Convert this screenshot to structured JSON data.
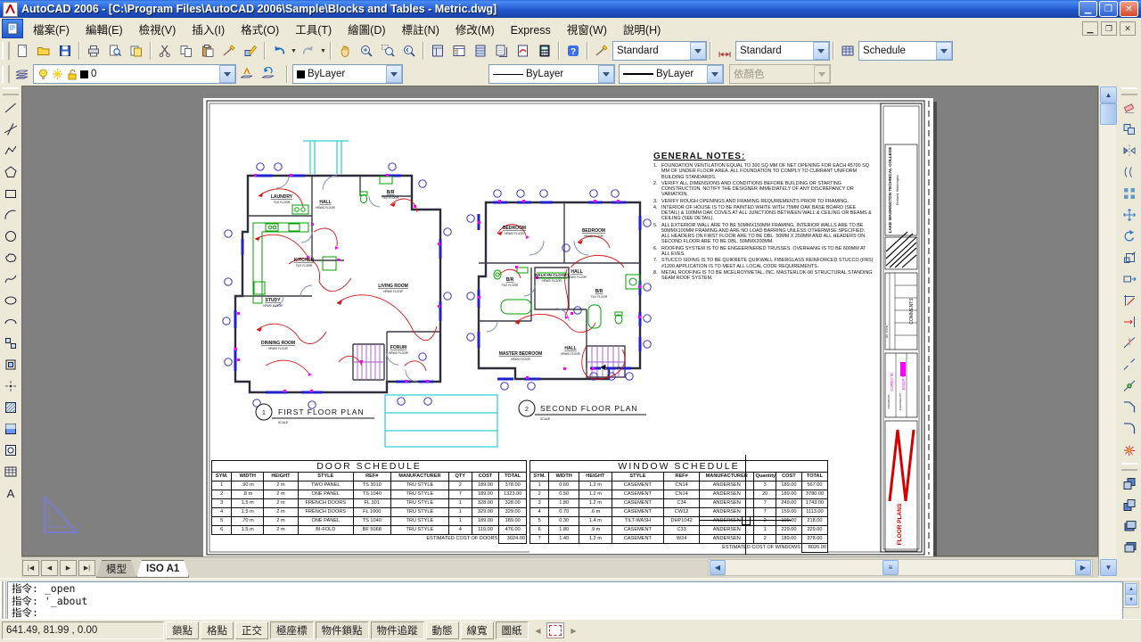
{
  "window": {
    "title": "AutoCAD 2006 - [C:\\Program Files\\AutoCAD 2006\\Sample\\Blocks and Tables - Metric.dwg]",
    "minimize": "_",
    "restore": "❐",
    "close": "✕"
  },
  "menu": {
    "items": [
      "檔案(F)",
      "編輯(E)",
      "檢視(V)",
      "插入(I)",
      "格式(O)",
      "工具(T)",
      "繪圖(D)",
      "標註(N)",
      "修改(M)",
      "Express",
      "視窗(W)",
      "說明(H)"
    ]
  },
  "toolbars": {
    "standard_icons": [
      "new",
      "open",
      "save",
      "plot",
      "plot-preview",
      "publish",
      "cut",
      "copy",
      "paste",
      "match-properties",
      "block-editor",
      "undo",
      "redo",
      "pan",
      "zoom-realtime",
      "zoom-window",
      "zoom-previous",
      "properties",
      "designcenter",
      "tool-palettes",
      "sheet-set-manager",
      "markup-set-manager",
      "quickcalc",
      "help"
    ],
    "styles": {
      "text_style": "Standard",
      "dim_style": "Standard",
      "table_style": "Schedule"
    },
    "layers": {
      "current_layer": "0"
    },
    "properties": {
      "color": "ByLayer",
      "linetype": "ByLayer",
      "lineweight": "ByLayer",
      "plot_style": "依顏色"
    },
    "draw_icons": [
      "line",
      "construction-line",
      "polyline",
      "polygon",
      "rectangle",
      "arc",
      "circle",
      "revision-cloud",
      "spline",
      "ellipse",
      "ellipse-arc",
      "insert-block",
      "make-block",
      "point",
      "hatch",
      "gradient",
      "region",
      "table",
      "multiline-text"
    ],
    "modify_icons": [
      "erase",
      "copy-object",
      "mirror",
      "offset",
      "array",
      "move",
      "rotate",
      "scale",
      "stretch",
      "trim",
      "extend",
      "break-at-point",
      "break",
      "join",
      "chamfer",
      "fillet",
      "explode"
    ],
    "draworder_icons": [
      "draworder-front",
      "draworder-back",
      "draworder-above",
      "draworder-under"
    ]
  },
  "drawing": {
    "plan1": {
      "tag": "1",
      "title": "FIRST FLOOR PLAN",
      "scale_note": "SCALE",
      "rooms": [
        {
          "name": "LAUNDRY",
          "floor": "TILE FLOOR"
        },
        {
          "name": "HALL",
          "floor": "HRWD FLOOR"
        },
        {
          "name": "B/R",
          "floor": "TILE FLOOR"
        },
        {
          "name": "KITCHEN",
          "floor": "TILE FLOOR"
        },
        {
          "name": "LIVING ROOM",
          "floor": "HRWD FLOOR"
        },
        {
          "name": "STUDY",
          "floor": "HRWD FLOOR"
        },
        {
          "name": "DINNING ROOM",
          "floor": "HRWD FLOOR"
        },
        {
          "name": "FORUM",
          "floor": "HRWD FLOOR"
        }
      ]
    },
    "plan2": {
      "tag": "2",
      "title": "SECOND FLOOR PLAN",
      "scale_note": "SCALE",
      "rooms": [
        {
          "name": "BEDROOM",
          "floor": "HRWD FLOOR"
        },
        {
          "name": "BEDROOM",
          "floor": "HRWD FLOOR"
        },
        {
          "name": "WALK-IN CLOSET",
          "floor": "HRWD FLOOR"
        },
        {
          "name": "HALL",
          "floor": "HRWD FLOOR"
        },
        {
          "name": "B/R",
          "floor": "TILE FLOOR"
        },
        {
          "name": "B/R",
          "floor": "TILE FLOOR"
        },
        {
          "name": "MASTER BEDROOM",
          "floor": "HRWD FLOOR"
        },
        {
          "name": "HALL",
          "floor": "HRWD FLOOR"
        }
      ]
    },
    "general_notes": {
      "title": "GENERAL NOTES:",
      "items": [
        "FOUNDATION VENTILATION EQUAL TO 300 SQ MM OF NET OPENING FOR EACH 45700 SQ MM OF UNDER FLOOR AREA. ALL FOUNDATION TO COMPLY TO CURRANT UNIFORM BUILDING STANDARDS.",
        "VERIFY ALL DIMENSIONS AND CONDITIONS BEFORE BUILDING OR STARTING CONSTRUCTION. NOTIFY THE DESIGNER IMMEDIATELY OF ANY DISCREPANCY OR VARIATION.",
        "VERIFY ROUGH OPENINGS AND FRAMING REQUIREMENTS PRIOR TO FRAMING.",
        "INTERIOR OF HOUSE IS TO BE PAINTED WHITE WITH 75MM OAK  BASE BOARD (SEE DETAIL) & 100MM OAK COVES AT ALL JUNCTIONS BETWEEN WALL & CEILING OR BEAMS & CEILING (SEE DETAIL).",
        "ALL EXTERIOR WALL ARE TO BE 50MMX150MM FRAMING. INTERIOR WALLS ARE TO BE 50MMX100MM FRAMING AND ARE NO LOAD BARRING UNLESS OTHERWISE SPECIFIED. ALL HEADERS ON FIRST FLOOR ARE TO BE DBL. 50MM X 250MM AND ALL HEADERS ON SECOND FLOOR ARE TO BE DBL. 50MMX200MM.",
        "ROOFING SYSTEM IS TO BE ENGEERINERED TRUSSES. OVERHANG IS TO BE 600MM AT ALL EVES.",
        "STUCCO SIDING IS TO BE QUIKRETE QUIKWALL FIBERGLASS REINFORCED STUCCO (FRS) #1200 APPLICATION IS TO MEET ALL LOCAL CODE REQUIREMENTS.",
        "METAL ROOFING IS TO BE MCELROYMETAL, INC. MASTERLOK-90 STRUCTURAL STANDING SEAM ROOF SYSTEM."
      ]
    },
    "schedules": {
      "door": {
        "title": "DOOR SCHEDULE",
        "headers": [
          "SYM.",
          "WIDTH",
          "HEIGHT",
          "STYLE",
          "REF#",
          "MANUFACTURER",
          "QTY",
          "COST",
          "TOTAL"
        ],
        "rows": [
          [
            "1",
            ".90 m",
            "2 m",
            "TWO PANEL",
            "TS 3010",
            "TRU STYLE",
            "2",
            "189.00",
            "378.00"
          ],
          [
            "2",
            ".8 m",
            "2 m",
            "ONE PANEL",
            "TS 1040",
            "TRU STYLE",
            "7",
            "189.00",
            "1323.00"
          ],
          [
            "3",
            "1.5 m",
            "2 m",
            "FRENCH DOORS",
            "FL 301",
            "TRU STYLE",
            "1",
            "328.00",
            "328.00"
          ],
          [
            "4",
            "1.5 m",
            "2 m",
            "FRENCH DOORS",
            "FL 1000",
            "TRU STYLE",
            "1",
            "329.00",
            "329.00"
          ],
          [
            "5",
            ".70 m",
            "2 m",
            "ONE PANEL",
            "TS 1040",
            "TRU STYLE",
            "1",
            "189.00",
            "189.00"
          ],
          [
            "6",
            "1.5 m",
            "2 m",
            "BI-FOLD",
            "BF 5068",
            "TRU STYLE",
            "4",
            "119.00",
            "476.00"
          ]
        ],
        "footer_label": "ESTIMATED COST OF DOORS",
        "footer_value": "3024.00"
      },
      "window": {
        "title": "WINDOW SCHEDULE",
        "headers": [
          "SYM.",
          "WIDTH",
          "HEIGHT",
          "STYLE",
          "REF#",
          "MANUFACTURER",
          "Quantity",
          "COST",
          "TOTAL"
        ],
        "rows": [
          [
            "1",
            "0.60",
            "1.2 m",
            "CASEMENT",
            "CN14",
            "ANDERSEN",
            "3",
            "189.00",
            "567.00"
          ],
          [
            "2",
            "0.50",
            "1.2 m",
            "CASEMENT",
            "CN14",
            "ANDERSEN",
            "20",
            "189.00",
            "3780.00"
          ],
          [
            "3",
            "1.80",
            "1.2 m",
            "CASEMENT",
            "C34",
            "ANDERSEN",
            "7",
            "249.00",
            "1743.00"
          ],
          [
            "4",
            "0.70",
            ".6 m",
            "CASEMENT",
            "CW12",
            "ANDERSEN",
            "7",
            "159.00",
            "1113.00"
          ],
          [
            "5",
            "0.30",
            "1.4 m",
            "TILT-WASH",
            "DHP1042",
            "ANDERSEN",
            "2",
            "109.00",
            "218.00"
          ],
          [
            "6",
            "1.80",
            ".9 m",
            "CASEMENT",
            "C33",
            "ANDERSEN",
            "1",
            "229.00",
            "229.00"
          ],
          [
            "7",
            "1.40",
            "1.2 m",
            "CASEMENT",
            "W24",
            "ANDERSEN",
            "2",
            "189.00",
            "378.00"
          ]
        ],
        "footer_label": "ESTIMATED COST OF WINDOWS",
        "footer_value": "8026.00"
      }
    },
    "title_block": {
      "college": "LAKE WASHINGTON TECHNICAL COLLEGE",
      "location": "Kirkland, Washington",
      "comments_label": "COMMENTS",
      "no_date_label": "NO. DATE",
      "drawn_label": "DRAWN BY:",
      "drawn_by": "COREY M.",
      "checked_label": "CHECKED BY:",
      "checked_by": "ENGR M.",
      "sheet_title": "FLOOR PLANS"
    }
  },
  "tabs": {
    "model": "模型",
    "layout": "ISO A1"
  },
  "command": {
    "history": [
      "指令:  _open",
      "指令:  '_about"
    ],
    "prompt": "指令:"
  },
  "status": {
    "coordinates": "641.49, 81.99 , 0.00",
    "toggles": [
      {
        "label": "鎖點",
        "pressed": false
      },
      {
        "label": "格點",
        "pressed": false
      },
      {
        "label": "正交",
        "pressed": false
      },
      {
        "label": "極座標",
        "pressed": true
      },
      {
        "label": "物件鎖點",
        "pressed": true
      },
      {
        "label": "物件追蹤",
        "pressed": true
      },
      {
        "label": "動態",
        "pressed": false
      },
      {
        "label": "線寬",
        "pressed": false
      },
      {
        "label": "圖紙",
        "pressed": true
      }
    ]
  },
  "colors": {
    "titlebar_blue": "#2358cf",
    "toolbar_tan": "#ece9d8",
    "canvas_gray": "#808080",
    "wall_dark": "#2e2e3a",
    "wiring_red": "#d91111",
    "fixture_green": "#00a000",
    "tag_blue": "#2121cc",
    "stair_purple": "#a05ac8",
    "deck_cyan": "#00c3c3",
    "outlet_magenta": "#ff00ff"
  }
}
